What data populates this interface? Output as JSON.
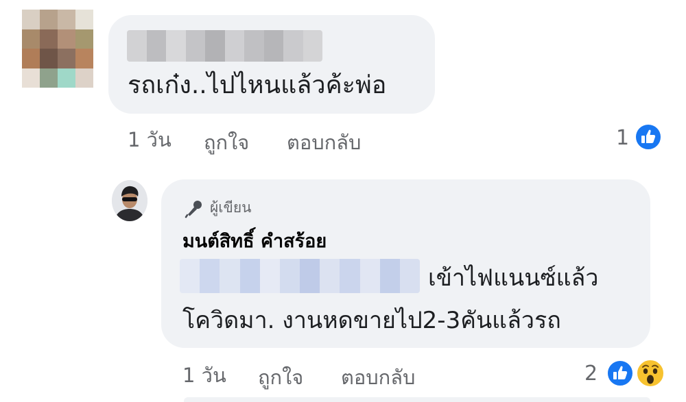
{
  "colors": {
    "bubble_bg": "#f0f2f5",
    "text_primary": "#1c1e21",
    "text_secondary": "#65676b",
    "like_blue": "#1877f2",
    "wow_yellow": "#f7c22f"
  },
  "comment": {
    "text": "รถเก๋ง..ไปไหนแล้วค้ะพ่อ",
    "time": "1 วัน",
    "like_label": "ถูกใจ",
    "reply_label": "ตอบกลับ",
    "reaction_count": "1",
    "reactions": [
      "like-icon"
    ]
  },
  "reply": {
    "badge_label": "ผู้เขียน",
    "badge_icon": "microphone-icon",
    "author_name": "มนต์สิทธิ์ คำสร้อย",
    "text_line_1": "เข้าไฟแนนซ์แล้ว",
    "text_line_2": "โควิดมา. งานหดขายไป2-3คันแล้วรถ",
    "time": "1 วัน",
    "like_label": "ถูกใจ",
    "reply_label": "ตอบกลับ",
    "reaction_count": "2",
    "reactions": [
      "like-icon",
      "wow-icon"
    ]
  }
}
